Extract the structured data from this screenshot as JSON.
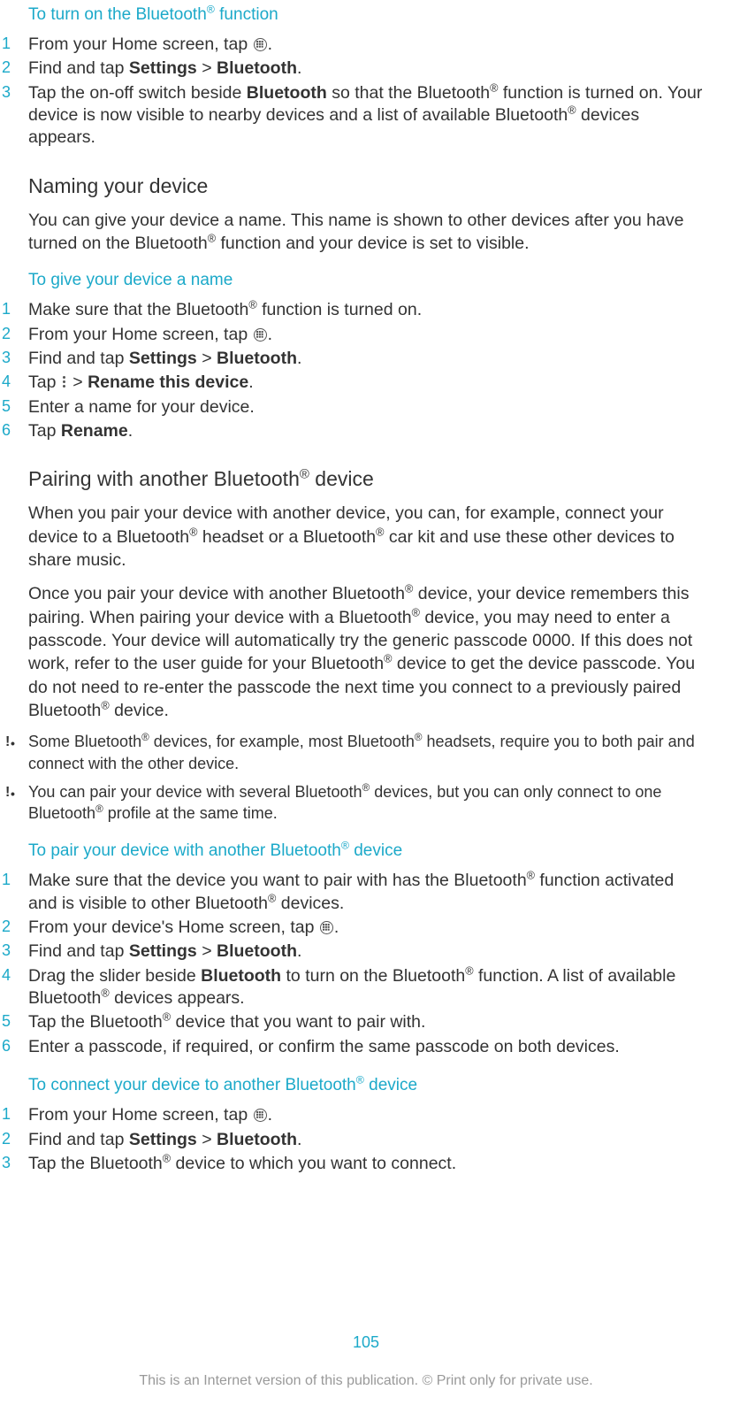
{
  "s1": {
    "heading_pre": "To turn on the Bluetooth",
    "heading_post": " function",
    "items": [
      {
        "n": "1",
        "pre": "From your Home screen, tap ",
        "post": "."
      },
      {
        "n": "2",
        "t1": "Find and tap ",
        "b1": "Settings",
        "t2": " > ",
        "b2": "Bluetooth",
        "t3": "."
      },
      {
        "n": "3",
        "t1": "Tap the on-off switch beside ",
        "b1": "Bluetooth",
        "t2": " so that the Bluetooth",
        "t3": " function is turned on. Your device is now visible to nearby devices and a list of available Bluetooth",
        "t4": " devices appears."
      }
    ]
  },
  "naming": {
    "heading": "Naming your device",
    "para_pre": "You can give your device a name. This name is shown to other devices after you have turned on the Bluetooth",
    "para_post": " function and your device is set to visible."
  },
  "s2": {
    "heading": "To give your device a name",
    "items": [
      {
        "n": "1",
        "t1": "Make sure that the Bluetooth",
        "t2": " function is turned on."
      },
      {
        "n": "2",
        "pre": "From your Home screen, tap ",
        "post": "."
      },
      {
        "n": "3",
        "t1": "Find and tap ",
        "b1": "Settings",
        "t2": " > ",
        "b2": "Bluetooth",
        "t3": "."
      },
      {
        "n": "4",
        "t1": "Tap ",
        "t2": " > ",
        "b1": "Rename this device",
        "t3": "."
      },
      {
        "n": "5",
        "t1": "Enter a name for your device."
      },
      {
        "n": "6",
        "t1": "Tap ",
        "b1": "Rename",
        "t2": "."
      }
    ]
  },
  "pairing": {
    "heading_pre": "Pairing with another Bluetooth",
    "heading_post": " device",
    "para1_a": "When you pair your device with another device, you can, for example, connect your device to a Bluetooth",
    "para1_b": " headset or a Bluetooth",
    "para1_c": " car kit and use these other devices to share music.",
    "para2_a": "Once you pair your device with another Bluetooth",
    "para2_b": " device, your device remembers this pairing. When pairing your device with a Bluetooth",
    "para2_c": " device, you may need to enter a passcode. Your device will automatically try the generic passcode 0000. If this does not work, refer to the user guide for your Bluetooth",
    "para2_d": " device to get the device passcode. You do not need to re-enter the passcode the next time you connect to a previously paired Bluetooth",
    "para2_e": " device.",
    "note1_a": "Some Bluetooth",
    "note1_b": " devices, for example, most Bluetooth",
    "note1_c": " headsets, require you to both pair and connect with the other device.",
    "note2_a": "You can pair your device with several Bluetooth",
    "note2_b": " devices, but you can only connect to one Bluetooth",
    "note2_c": " profile at the same time."
  },
  "s3": {
    "heading_pre": "To pair your device with another Bluetooth",
    "heading_post": " device",
    "items": [
      {
        "n": "1",
        "t1": "Make sure that the device you want to pair with has the Bluetooth",
        "t2": " function activated and is visible to other Bluetooth",
        "t3": " devices."
      },
      {
        "n": "2",
        "pre": "From your device's Home screen, tap ",
        "post": "."
      },
      {
        "n": "3",
        "t1": "Find and tap ",
        "b1": "Settings",
        "t2": " > ",
        "b2": "Bluetooth",
        "t3": "."
      },
      {
        "n": "4",
        "t1": "Drag the slider beside ",
        "b1": "Bluetooth",
        "t2": " to turn on the Bluetooth",
        "t3": " function. A list of available Bluetooth",
        "t4": " devices appears."
      },
      {
        "n": "5",
        "t1": "Tap the Bluetooth",
        "t2": " device that you want to pair with."
      },
      {
        "n": "6",
        "t1": "Enter a passcode, if required, or confirm the same passcode on both devices."
      }
    ]
  },
  "s4": {
    "heading_pre": "To connect your device to another Bluetooth",
    "heading_post": " device",
    "items": [
      {
        "n": "1",
        "pre": "From your Home screen, tap ",
        "post": "."
      },
      {
        "n": "2",
        "t1": "Find and tap ",
        "b1": "Settings",
        "t2": " > ",
        "b2": "Bluetooth",
        "t3": "."
      },
      {
        "n": "3",
        "t1": "Tap the Bluetooth",
        "t2": " device to which you want to connect."
      }
    ]
  },
  "page_number": "105",
  "footer": "This is an Internet version of this publication. © Print only for private use.",
  "reg": "®"
}
